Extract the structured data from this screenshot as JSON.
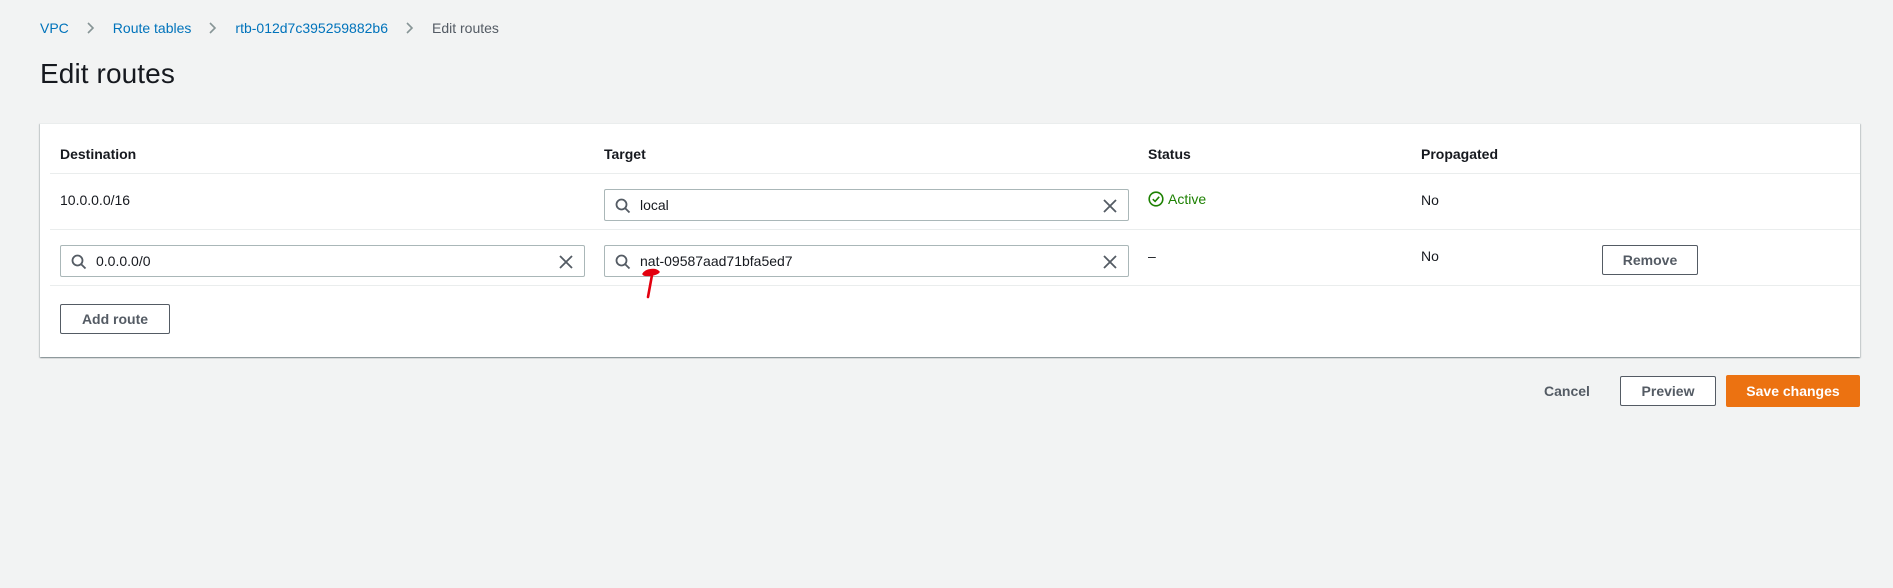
{
  "breadcrumb": {
    "items": [
      "VPC",
      "Route tables",
      "rtb-012d7c395259882b6"
    ],
    "current": "Edit routes"
  },
  "page_title": "Edit routes",
  "columns": {
    "destination": "Destination",
    "target": "Target",
    "status": "Status",
    "propagated": "Propagated"
  },
  "routes": [
    {
      "destination": "10.0.0.0/16",
      "target": "local",
      "status": "Active",
      "propagated": "No"
    },
    {
      "destination": "0.0.0.0/0",
      "target": "nat-09587aad71bfa5ed7",
      "status": "–",
      "propagated": "No",
      "remove_label": "Remove"
    }
  ],
  "add_route_label": "Add route",
  "footer": {
    "cancel_label": "Cancel",
    "preview_label": "Preview",
    "save_label": "Save changes"
  },
  "colors": {
    "link": "#0073bb",
    "primary": "#ec7211",
    "success": "#1d8102",
    "annotation": "#e3000f"
  },
  "icons": {
    "breadcrumb_separator": "chevron-right-icon",
    "input_search": "search-icon",
    "input_clear": "close-icon",
    "status_active": "check-circle-icon"
  }
}
